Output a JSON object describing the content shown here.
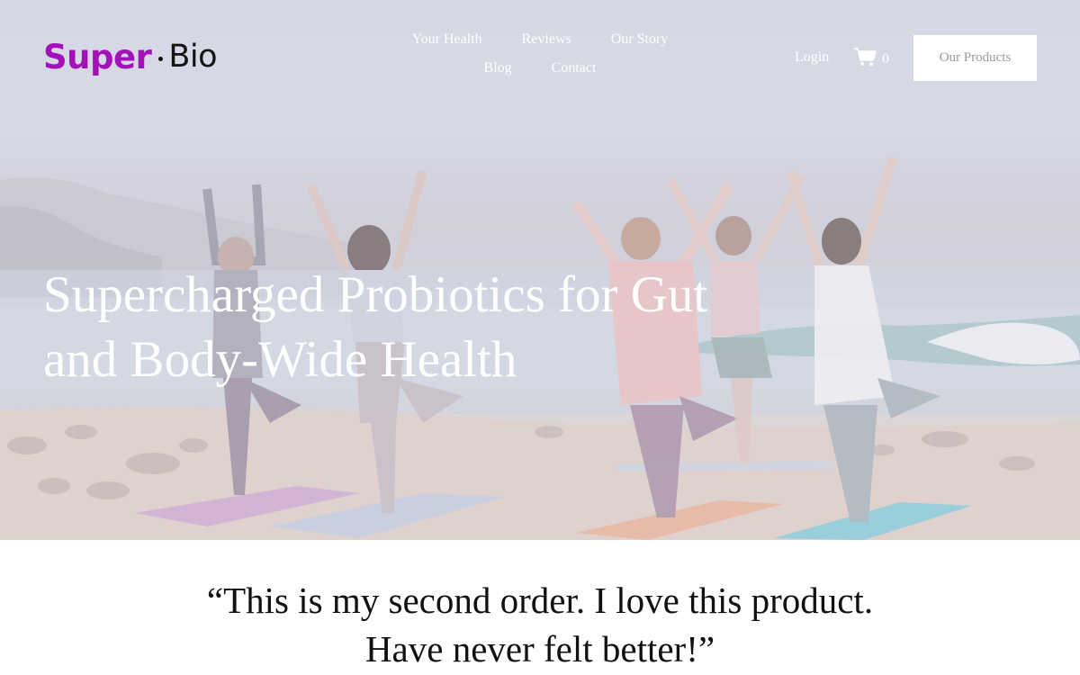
{
  "brand": {
    "name_part1": "Super",
    "name_part2": "Bio",
    "accent_color": "#a312b8"
  },
  "nav": {
    "items": [
      "Your Health",
      "Reviews",
      "Our Story",
      "Blog",
      "Contact"
    ]
  },
  "header": {
    "login_label": "Login",
    "cart_icon": "shopping-cart-icon",
    "cart_count": "0",
    "cta_label": "Our Products"
  },
  "hero": {
    "headline_line1": "Supercharged Probiotics for Gut",
    "headline_line2": "and Body-Wide Health",
    "image_subject": "women doing tree-pose yoga on a beach"
  },
  "testimonial": {
    "line1": "“This is my second order. I love this product.",
    "line2": "Have never felt better!”"
  }
}
